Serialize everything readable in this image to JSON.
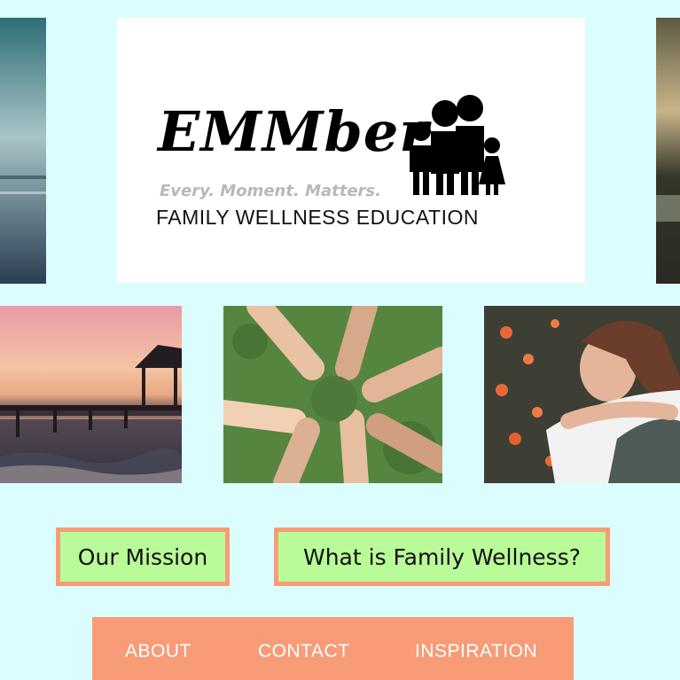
{
  "logo": {
    "wordmark": "EMMber",
    "tagline": "Every. Moment. Matters.",
    "subtitle": "FAMILY WELLNESS EDUCATION",
    "icon": "family-silhouette-icon"
  },
  "photos": [
    {
      "subject": "ocean-horizon-photo"
    },
    {
      "subject": "lake-shore-photo"
    },
    {
      "subject": "sunset-pier-photo"
    },
    {
      "subject": "linked-hands-photo"
    },
    {
      "subject": "hugging-friends-photo"
    }
  ],
  "buttons": {
    "mission": "Our Mission",
    "wellness": "What is Family Wellness?"
  },
  "nav": {
    "about": "ABOUT",
    "contact": "CONTACT",
    "inspiration": "INSPIRATION"
  },
  "colors": {
    "page_bg": "#dcfdfd",
    "button_fill": "#b8fb98",
    "accent": "#f79c77",
    "nav_text": "#ffffff"
  }
}
